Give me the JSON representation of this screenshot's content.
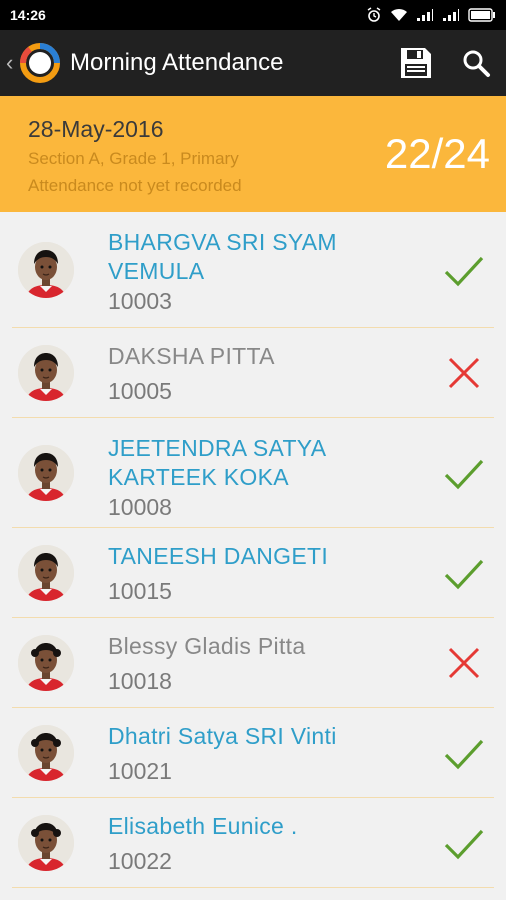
{
  "status_bar": {
    "time": "14:26"
  },
  "app_bar": {
    "title": "Morning Attendance"
  },
  "banner": {
    "date": "28-May-2016",
    "section": "Section A, Grade 1, Primary",
    "status": "Attendance not yet recorded",
    "count": "22/24"
  },
  "colors": {
    "accent": "#fbb73c",
    "present": "#5c9e2e",
    "absent": "#e53935",
    "name_link": "#2f9ec9"
  },
  "students": [
    {
      "name_line1": "BHARGVA  SRI SYAM",
      "name_line2": "VEMULA",
      "roll": "10003",
      "present": true,
      "gender": "boy"
    },
    {
      "name_line1": "DAKSHA PITTA",
      "name_line2": "",
      "roll": "10005",
      "present": false,
      "gender": "boy"
    },
    {
      "name_line1": "JEETENDRA SATYA",
      "name_line2": "KARTEEK KOKA",
      "roll": "10008",
      "present": true,
      "gender": "boy"
    },
    {
      "name_line1": "TANEESH DANGETI",
      "name_line2": "",
      "roll": "10015",
      "present": true,
      "gender": "boy"
    },
    {
      "name_line1": "Blessy Gladis Pitta",
      "name_line2": "",
      "roll": "10018",
      "present": false,
      "gender": "girl"
    },
    {
      "name_line1": "Dhatri Satya SRI Vinti",
      "name_line2": "",
      "roll": "10021",
      "present": true,
      "gender": "girl"
    },
    {
      "name_line1": "Elisabeth  Eunice .",
      "name_line2": "",
      "roll": "10022",
      "present": true,
      "gender": "girl"
    }
  ]
}
